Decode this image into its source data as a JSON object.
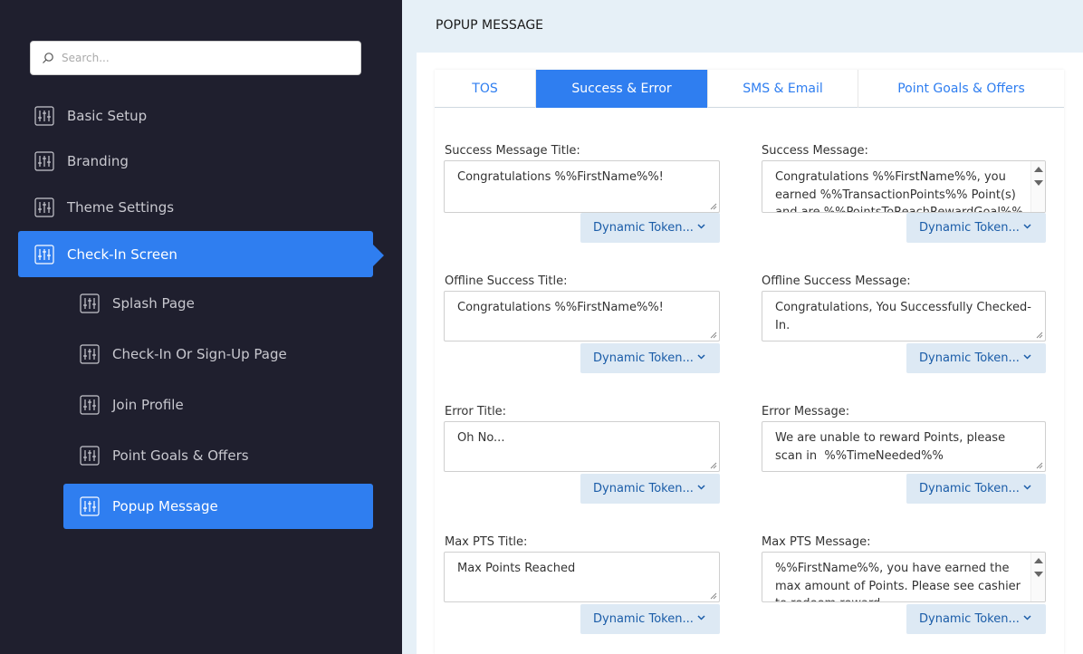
{
  "sidebar": {
    "search_placeholder": "Search...",
    "items": [
      {
        "label": "Basic Setup"
      },
      {
        "label": "Branding"
      },
      {
        "label": "Theme Settings"
      },
      {
        "label": "Check-In Screen"
      },
      {
        "label": "Splash Page"
      },
      {
        "label": "Check-In Or Sign-Up Page"
      },
      {
        "label": "Join Profile"
      },
      {
        "label": "Point Goals & Offers"
      },
      {
        "label": "Popup Message"
      }
    ]
  },
  "header": {
    "title": "POPUP MESSAGE"
  },
  "tabs": [
    "TOS",
    "Success & Error",
    "SMS & Email",
    "Point Goals & Offers"
  ],
  "token_label": "Dynamic Token...",
  "fields": {
    "success_title_label": "Success Message Title:",
    "success_title_value": "Congratulations %%FirstName%%!",
    "success_msg_label": "Success Message:",
    "success_msg_value": "Congratulations %%FirstName%%, you earned %%TransactionPoints%% Point(s) and are %%PointsToReachRewardGoal%%",
    "offline_title_label": "Offline Success Title:",
    "offline_title_value": "Congratulations %%FirstName%%!",
    "offline_msg_label": "Offline Success Message:",
    "offline_msg_value": "Congratulations, You Successfully Checked-In.",
    "error_title_label": "Error Title:",
    "error_title_value": "Oh No...",
    "error_msg_label": "Error Message:",
    "error_msg_value": "We are unable to reward Points, please scan in  %%TimeNeeded%%",
    "maxpts_title_label": "Max PTS Title:",
    "maxpts_title_value": "Max Points Reached",
    "maxpts_msg_label": "Max PTS Message:",
    "maxpts_msg_value": "%%FirstName%%, you have earned the max amount of Points. Please see cashier to redeem reward."
  },
  "colors": {
    "accent": "#2f7ef0",
    "sidebar_bg": "#1f1f2e",
    "token_bg": "#dde9f4"
  }
}
